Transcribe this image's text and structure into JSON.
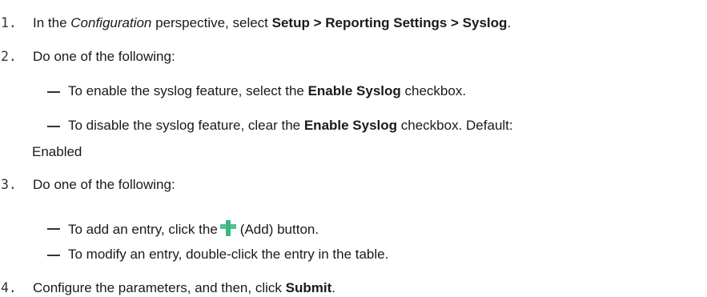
{
  "steps": [
    {
      "number": "1.",
      "pre": "In the ",
      "perspective": "Configuration",
      "mid": " perspective, select ",
      "menu_path": "Setup > Reporting Settings > Syslog",
      "end": "."
    },
    {
      "number": "2.",
      "text": "Do one of the following:",
      "options": [
        {
          "pre": "To enable the syslog feature, select the ",
          "bold": "Enable Syslog",
          "post": " checkbox."
        },
        {
          "pre": "To disable the syslog feature, clear the ",
          "bold": "Enable Syslog",
          "post": " checkbox.  Default:",
          "continuation": "Enabled"
        }
      ]
    },
    {
      "number": "3.",
      "text": "Do one of the following:",
      "options": [
        {
          "pre": "To add an entry, click the",
          "icon": "add-plus-icon",
          "post": "(Add) button."
        },
        {
          "text": "To modify an entry, double-click the entry in the table."
        }
      ]
    },
    {
      "number": "4.",
      "pre": "Configure the parameters, and then, click ",
      "bold": "Submit",
      "end": "."
    }
  ]
}
